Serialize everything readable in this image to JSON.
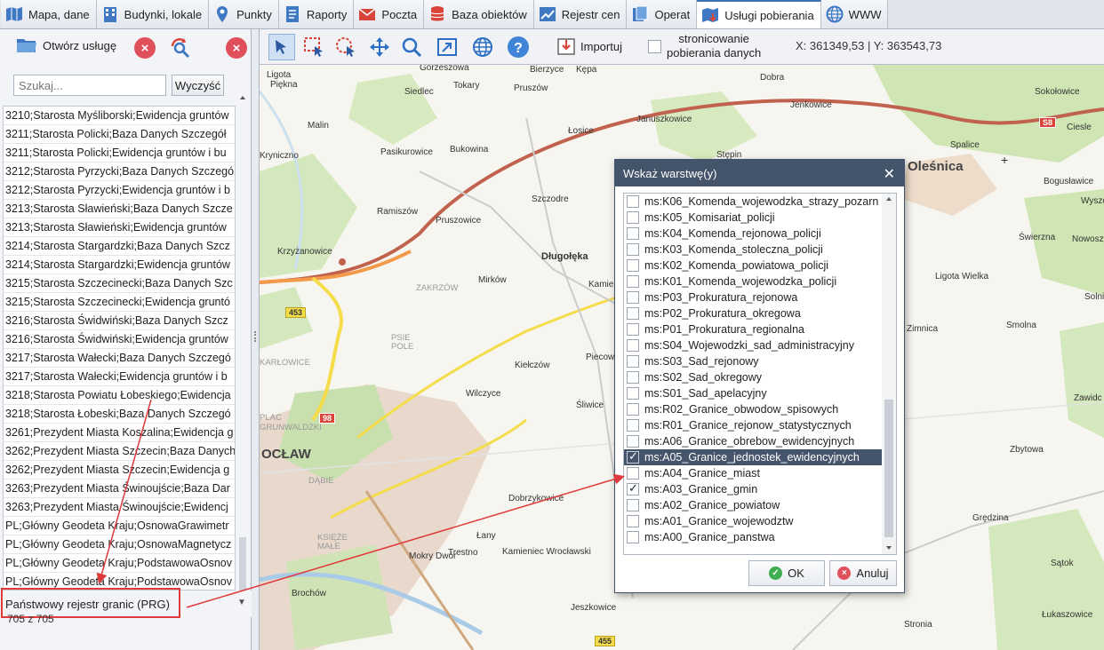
{
  "tabs": [
    {
      "label": "Mapa, dane",
      "icon": "map-icon"
    },
    {
      "label": "Budynki, lokale",
      "icon": "building-icon"
    },
    {
      "label": "Punkty",
      "icon": "pin-icon"
    },
    {
      "label": "Raporty",
      "icon": "report-icon"
    },
    {
      "label": "Poczta",
      "icon": "mail-icon"
    },
    {
      "label": "Baza obiektów",
      "icon": "database-icon"
    },
    {
      "label": "Rejestr cen",
      "icon": "chart-icon"
    },
    {
      "label": "Operat",
      "icon": "document-icon"
    },
    {
      "label": "Usługi pobierania",
      "icon": "download-map-icon",
      "active": true
    },
    {
      "label": "WWW",
      "icon": "globe-icon"
    }
  ],
  "left": {
    "open_label": "Otwórz usługę",
    "search_placeholder": "Szukaj...",
    "clear_label": "Wyczyść",
    "services": [
      "3210;Starosta Myśliborski;Ewidencja gruntów",
      "3211;Starosta Policki;Baza Danych Szczegół",
      "3211;Starosta Policki;Ewidencja gruntów i bu",
      "3212;Starosta Pyrzycki;Baza Danych Szczegó",
      "3212;Starosta Pyrzycki;Ewidencja gruntów i b",
      "3213;Starosta Sławieński;Baza Danych Szcze",
      "3213;Starosta Sławieński;Ewidencja gruntów",
      "3214;Starosta Stargardzki;Baza Danych Szcz",
      "3214;Starosta Stargardzki;Ewidencja gruntów",
      "3215;Starosta Szczecinecki;Baza Danych Szc",
      "3215;Starosta Szczecinecki;Ewidencja gruntó",
      "3216;Starosta Świdwiński;Baza Danych Szcz",
      "3216;Starosta Świdwiński;Ewidencja gruntów",
      "3217;Starosta Wałecki;Baza Danych Szczegó",
      "3217;Starosta Wałecki;Ewidencja gruntów i b",
      "3218;Starosta Powiatu Łobeskiego;Ewidencja",
      "3218;Starosta Łobeski;Baza Danych Szczegó",
      "3261;Prezydent Miasta Koszalina;Ewidencja g",
      "3262;Prezydent Miasta Szczecin;Baza Danych",
      "3262;Prezydent Miasta Szczecin;Ewidencja g",
      "3263;Prezydent Miasta Świnoujście;Baza Dar",
      "3263;Prezydent Miasta Świnoujście;Ewidencj",
      "PL;Główny Geodeta Kraju;OsnowaGrawimetr",
      "PL;Główny Geodeta Kraju;OsnowaMagnetycz",
      "PL;Główny Geodeta Kraju;PodstawowaOsnov",
      "PL;Główny Geodeta Kraju;PodstawowaOsnov"
    ],
    "selected_service": "Państwowy rejestr granic (PRG)",
    "count": "705 z 705"
  },
  "map_toolbar": {
    "import_label": "Importuj",
    "paging_line1": "stronicowanie",
    "paging_line2": "pobierania danych",
    "coords": "X: 361349,53 | Y: 363543,73"
  },
  "map": {
    "places": [
      "Gorzeszowa",
      "Bierzyce",
      "Kępa",
      "Ligota",
      "Piękna",
      "Tokary",
      "Pruszów",
      "Dobra",
      "Siedlec",
      "Januszkowice",
      "Jenkowice",
      "Sokołowice",
      "Malin",
      "Łosice",
      "Ciesle",
      "Kryniczno",
      "Pasikurowice",
      "Bukowina",
      "Stępin",
      "Spalice",
      "Oleśnica",
      "Bogusławice",
      "Ramiszów",
      "Pruszowice",
      "Szczodre",
      "Wyszo",
      "Krzyżanowice",
      "Długołęka",
      "Kamie",
      "Świerzna",
      "Nowoszyc",
      "Mirków",
      "Ligota Wielka",
      "Solniki Wielkie",
      "Kiełczów",
      "Piecow",
      "Zimnica",
      "Smolna",
      "Wilczyce",
      "Śliwice",
      "Zawidc",
      "OCŁAW",
      "Zbytowa",
      "Dobrzykowice",
      "Grędzina",
      "Łany",
      "Mokry Dwór",
      "Trestno",
      "Kamieniec Wrocławski",
      "Sątok",
      "Jeszkowice",
      "Łukaszowice",
      "Stronia",
      "Brochów"
    ],
    "districts": [
      "ZAKRZÓW",
      "PSIE POLE",
      "KARŁOWICE",
      "PLAC GRUNWALDZKI",
      "DĄBIE",
      "KSIĘŻE MAŁE"
    ],
    "roads": [
      "S8",
      "453",
      "98",
      "455"
    ]
  },
  "dialog": {
    "title": "Wskaż warstwę(y)",
    "layers": [
      {
        "name": "ms:K06_Komenda_wojewodzka_strazy_pozarn",
        "checked": false
      },
      {
        "name": "ms:K05_Komisariat_policji",
        "checked": false
      },
      {
        "name": "ms:K04_Komenda_rejonowa_policji",
        "checked": false
      },
      {
        "name": "ms:K03_Komenda_stoleczna_policji",
        "checked": false
      },
      {
        "name": "ms:K02_Komenda_powiatowa_policji",
        "checked": false
      },
      {
        "name": "ms:K01_Komenda_wojewodzka_policji",
        "checked": false
      },
      {
        "name": "ms:P03_Prokuratura_rejonowa",
        "checked": false
      },
      {
        "name": "ms:P02_Prokuratura_okregowa",
        "checked": false
      },
      {
        "name": "ms:P01_Prokuratura_regionalna",
        "checked": false
      },
      {
        "name": "ms:S04_Wojewodzki_sad_administracyjny",
        "checked": false
      },
      {
        "name": "ms:S03_Sad_rejonowy",
        "checked": false
      },
      {
        "name": "ms:S02_Sad_okregowy",
        "checked": false
      },
      {
        "name": "ms:S01_Sad_apelacyjny",
        "checked": false
      },
      {
        "name": "ms:R02_Granice_obwodow_spisowych",
        "checked": false
      },
      {
        "name": "ms:R01_Granice_rejonow_statystycznych",
        "checked": false
      },
      {
        "name": "ms:A06_Granice_obrebow_ewidencyjnych",
        "checked": false
      },
      {
        "name": "ms:A05_Granice_jednostek_ewidencyjnych",
        "checked": true,
        "selected": true
      },
      {
        "name": "ms:A04_Granice_miast",
        "checked": false
      },
      {
        "name": "ms:A03_Granice_gmin",
        "checked": true
      },
      {
        "name": "ms:A02_Granice_powiatow",
        "checked": false
      },
      {
        "name": "ms:A01_Granice_wojewodztw",
        "checked": false
      },
      {
        "name": "ms:A00_Granice_panstwa",
        "checked": false
      }
    ],
    "ok_label": "OK",
    "cancel_label": "Anuluj"
  },
  "colors": {
    "accent": "#44546a",
    "highlight": "#e0393b",
    "road_red": "#d9453a",
    "road_yellow": "#f4dc4a"
  }
}
